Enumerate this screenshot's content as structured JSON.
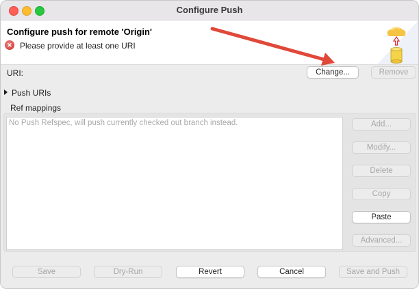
{
  "window": {
    "title": "Configure Push"
  },
  "banner": {
    "title": "Configure push for remote 'Origin'",
    "error_icon_glyph": "✕",
    "error_message": "Please provide at least one URI"
  },
  "uri": {
    "label": "URI:",
    "change_button": "Change...",
    "remove_button": "Remove"
  },
  "push_uris": {
    "label": "Push URIs",
    "expanded": false
  },
  "ref_mappings": {
    "label": "Ref mappings",
    "placeholder": "No Push Refspec, will push currently checked out branch instead.",
    "buttons": {
      "add": "Add...",
      "modify": "Modify...",
      "delete": "Delete",
      "copy": "Copy",
      "paste": "Paste",
      "advanced": "Advanced..."
    }
  },
  "footer": {
    "save": "Save",
    "dry_run": "Dry-Run",
    "revert": "Revert",
    "cancel": "Cancel",
    "save_and_push": "Save and Push"
  },
  "colors": {
    "annotation_arrow": "#e0483a",
    "traffic_red": "#ff5f57",
    "traffic_yellow": "#febc2e",
    "traffic_green": "#28c840"
  }
}
